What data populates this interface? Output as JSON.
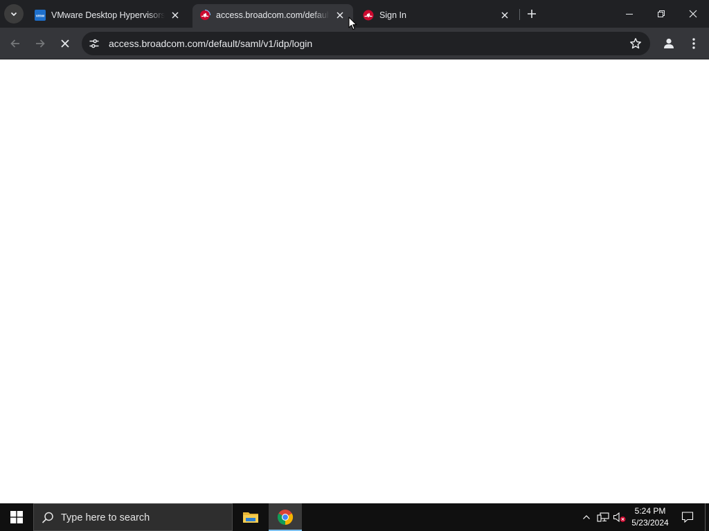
{
  "browser": {
    "tabs": [
      {
        "title": "VMware Desktop Hypervisors fo",
        "favicon": "vmware-icon",
        "active": false
      },
      {
        "title": "access.broadcom.com/default/s",
        "favicon": "broadcom-loading-icon",
        "active": true
      },
      {
        "title": "Sign In",
        "favicon": "broadcom-icon",
        "active": false
      }
    ],
    "url": "access.broadcom.com/default/saml/v1/idp/login",
    "page_state": "loading",
    "accent_color": "#cc092f"
  },
  "taskbar": {
    "search_placeholder": "Type here to search",
    "apps": [
      "file-explorer-icon",
      "chrome-icon"
    ],
    "clock": {
      "time": "5:24 PM",
      "date": "5/23/2024"
    }
  }
}
